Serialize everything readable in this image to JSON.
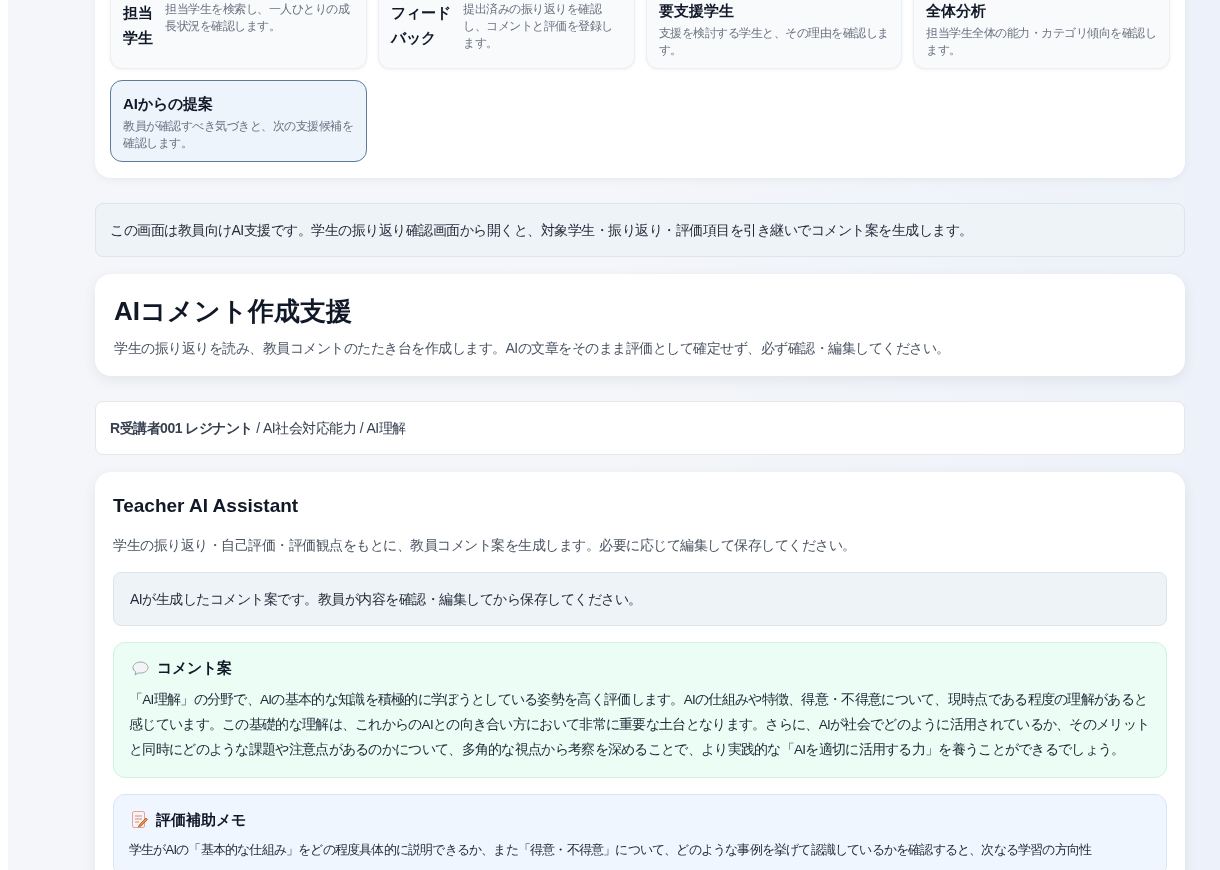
{
  "nav_cards": [
    {
      "kind": "side",
      "title": "担当学生",
      "description": "担当学生を検索し、一人ひとりの成長状況を確認します。",
      "selected": false
    },
    {
      "kind": "side",
      "title": "フィードバック",
      "description": "提出済みの振り返りを確認し、コメントと評価を登録します。",
      "selected": false
    },
    {
      "kind": "stacked",
      "title": "要支援学生",
      "description": "支援を検討する学生と、その理由を確認します。",
      "selected": false
    },
    {
      "kind": "stacked",
      "title": "全体分析",
      "description": "担当学生全体の能力・カテゴリ傾向を確認します。",
      "selected": false
    },
    {
      "kind": "stacked",
      "title": "AIからの提案",
      "description": "教員が確認すべき気づきと、次の支援候補を確認します。",
      "selected": true
    }
  ],
  "info_banner": "この画面は教員向けAI支援です。学生の振り返り確認画面から開くと、対象学生・振り返り・評価項目を引き継いでコメント案を生成します。",
  "header": {
    "title": "AIコメント作成支援",
    "subtitle": "学生の振り返りを読み、教員コメントのたたき台を作成します。AIの文章をそのまま評価として確定せず、必ず確認・編集してください。"
  },
  "breadcrumb": "**R受講者001 レジナント** / AI社会対応能力 / AI理解",
  "assistant": {
    "title": "Teacher AI Assistant",
    "subtitle": "学生の振り返り・自己評価・評価観点をもとに、教員コメント案を生成します。必要に応じて編集して保存してください。",
    "notice": "AIが生成したコメント案です。教員が内容を確認・編集してから保存してください。",
    "sections": [
      {
        "kind": "comment",
        "title": "コメント案",
        "body": "「AI理解」の分野で、AIの基本的な知識を積極的に学ぼうとしている姿勢を高く評価します。AIの仕組みや特徴、得意・不得意について、現時点である程度の理解があると感じています。この基礎的な理解は、これからのAIとの向き合い方において非常に重要な土台となります。さらに、AIが社会でどのように活用されているか、そのメリットと同時にどのような課題や注意点があるのかについて、多角的な視点から考察を深めることで、より実践的な「AIを適切に活用する力」を養うことができるでしょう。"
      },
      {
        "kind": "memo",
        "title": "評価補助メモ",
        "body": "学生がAIの「基本的な仕組み」をどの程度具体的に説明できるか、また「得意・不得意」について、どのような事例を挙げて認識しているかを確認すると、次なる学習の方向性"
      }
    ]
  }
}
